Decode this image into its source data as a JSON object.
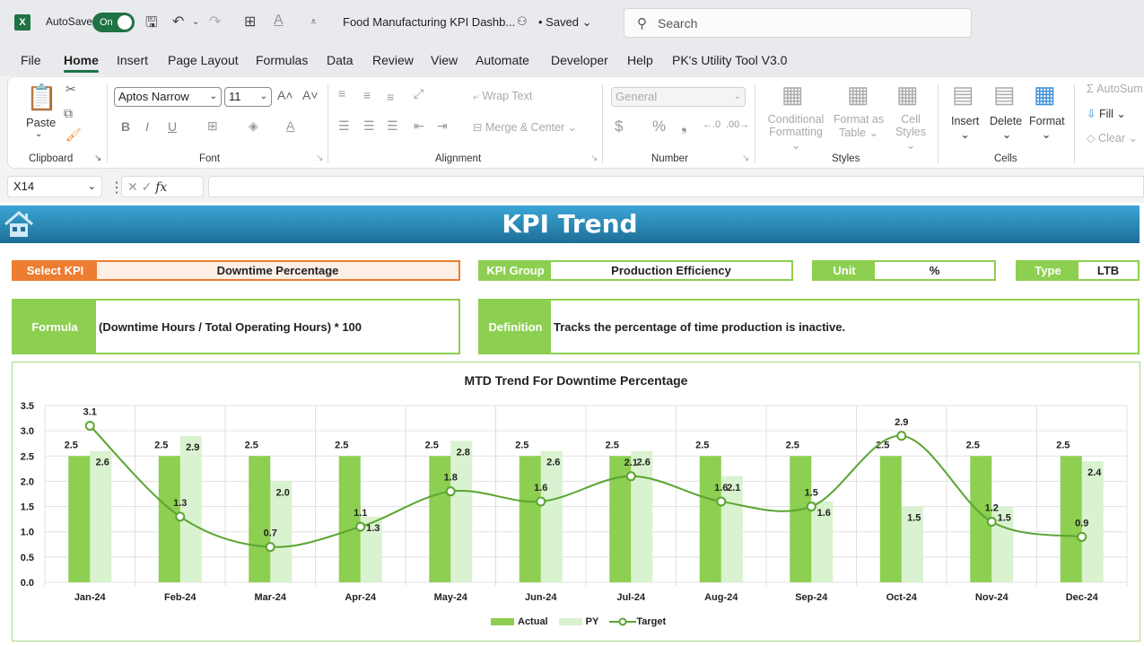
{
  "app": {
    "autosave_label": "AutoSave",
    "autosave_state": "On",
    "document_title": "Food Manufacturing KPI Dashb...",
    "save_status": "• Saved",
    "search_placeholder": "Search"
  },
  "menu": {
    "tabs": [
      "File",
      "Home",
      "Insert",
      "Page Layout",
      "Formulas",
      "Data",
      "Review",
      "View",
      "Automate",
      "Developer",
      "Help",
      "PK's Utility Tool V3.0"
    ],
    "active": "Home"
  },
  "ribbon": {
    "clipboard": {
      "paste": "Paste",
      "group": "Clipboard"
    },
    "font": {
      "name": "Aptos Narrow",
      "size": "11",
      "group": "Font",
      "bold": "B",
      "italic": "I",
      "underline": "U"
    },
    "alignment": {
      "wrap_text": "Wrap Text",
      "merge_center": "Merge & Center",
      "group": "Alignment"
    },
    "number": {
      "format": "General",
      "currency": "$",
      "percent": "%",
      "comma": "❟",
      "group": "Number"
    },
    "styles": {
      "conditional": "Conditional",
      "conditional2": "Formatting",
      "format_table": "Format as",
      "format_table2": "Table",
      "cell_styles": "Cell",
      "cell_styles2": "Styles",
      "group": "Styles"
    },
    "cells": {
      "insert": "Insert",
      "delete": "Delete",
      "format": "Format",
      "group": "Cells"
    },
    "editing": {
      "autosum": "AutoSum",
      "fill": "Fill",
      "clear": "Clear"
    }
  },
  "formula_bar": {
    "cell_ref": "X14",
    "fx": "fx",
    "value": ""
  },
  "dashboard": {
    "title": "KPI Trend",
    "select_kpi_label": "Select KPI",
    "select_kpi_value": "Downtime Percentage",
    "kpi_group_label": "KPI Group",
    "kpi_group_value": "Production Efficiency",
    "unit_label": "Unit",
    "unit_value": "%",
    "type_label": "Type",
    "type_value": "LTB",
    "formula_label": "Formula",
    "formula_value": "(Downtime Hours / Total Operating Hours) * 100",
    "definition_label": "Definition",
    "definition_value": "Tracks the percentage of time production is inactive."
  },
  "colors": {
    "actual": "#8dcf50",
    "py": "#d9f2cf",
    "target": "#5aa531",
    "accent_orange": "#ed7d31",
    "banner": "#1d6e97"
  },
  "chart_data": {
    "type": "bar",
    "title": "MTD Trend For Downtime Percentage",
    "xlabel": "",
    "ylabel": "",
    "ylim": [
      0,
      3.5
    ],
    "yticks": [
      "0.0",
      "0.5",
      "1.0",
      "1.5",
      "2.0",
      "2.5",
      "3.0",
      "3.5"
    ],
    "grid": true,
    "legend_position": "bottom",
    "categories": [
      "Jan-24",
      "Feb-24",
      "Mar-24",
      "Apr-24",
      "May-24",
      "Jun-24",
      "Jul-24",
      "Aug-24",
      "Sep-24",
      "Oct-24",
      "Nov-24",
      "Dec-24"
    ],
    "series": [
      {
        "name": "Actual",
        "type": "bar",
        "values": [
          2.5,
          2.5,
          2.5,
          2.5,
          2.5,
          2.5,
          2.5,
          2.5,
          2.5,
          2.5,
          2.5,
          2.5
        ]
      },
      {
        "name": "PY",
        "type": "bar",
        "values": [
          2.6,
          2.9,
          2.0,
          1.3,
          2.8,
          2.6,
          2.6,
          2.1,
          1.6,
          1.5,
          1.5,
          2.4
        ]
      },
      {
        "name": "Target",
        "type": "line",
        "values": [
          3.1,
          1.3,
          0.7,
          1.1,
          1.8,
          1.6,
          2.1,
          1.6,
          1.5,
          2.9,
          1.2,
          0.9
        ]
      }
    ]
  }
}
